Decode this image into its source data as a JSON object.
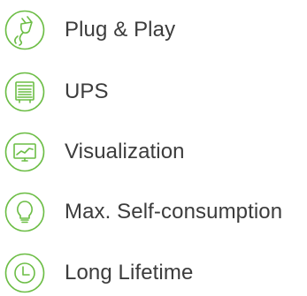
{
  "accent_color": "#6cbd45",
  "text_color": "#3c3c3c",
  "features": [
    {
      "label": "Plug & Play",
      "icon": "plug-icon"
    },
    {
      "label": "UPS",
      "icon": "ups-device-icon"
    },
    {
      "label": "Visualization",
      "icon": "monitor-chart-icon"
    },
    {
      "label": "Max. Self-consumption",
      "icon": "lightbulb-icon"
    },
    {
      "label": "Long Lifetime",
      "icon": "clock-icon"
    }
  ]
}
